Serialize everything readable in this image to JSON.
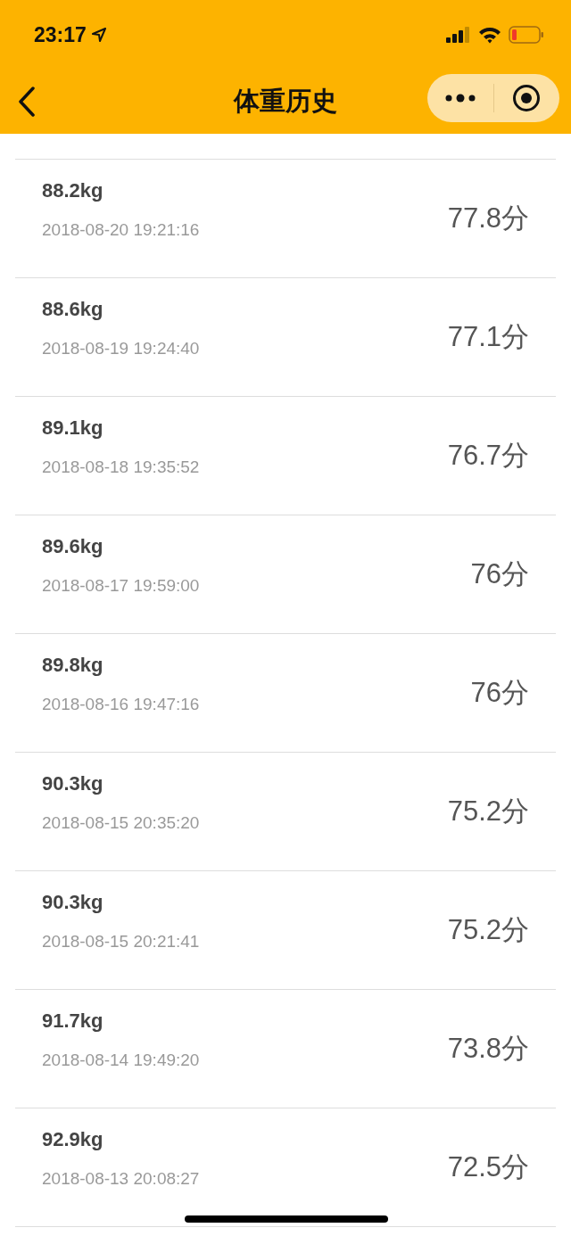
{
  "status_bar": {
    "time": "23:17"
  },
  "nav": {
    "title": "体重历史"
  },
  "records": [
    {
      "weight": "88.2kg",
      "time": "2018-08-20 19:21:16",
      "score": "77.8分"
    },
    {
      "weight": "88.6kg",
      "time": "2018-08-19 19:24:40",
      "score": "77.1分"
    },
    {
      "weight": "89.1kg",
      "time": "2018-08-18 19:35:52",
      "score": "76.7分"
    },
    {
      "weight": "89.6kg",
      "time": "2018-08-17 19:59:00",
      "score": "76分"
    },
    {
      "weight": "89.8kg",
      "time": "2018-08-16 19:47:16",
      "score": "76分"
    },
    {
      "weight": "90.3kg",
      "time": "2018-08-15 20:35:20",
      "score": "75.2分"
    },
    {
      "weight": "90.3kg",
      "time": "2018-08-15 20:21:41",
      "score": "75.2分"
    },
    {
      "weight": "91.7kg",
      "time": "2018-08-14 19:49:20",
      "score": "73.8分"
    },
    {
      "weight": "92.9kg",
      "time": "2018-08-13 20:08:27",
      "score": "72.5分"
    }
  ]
}
